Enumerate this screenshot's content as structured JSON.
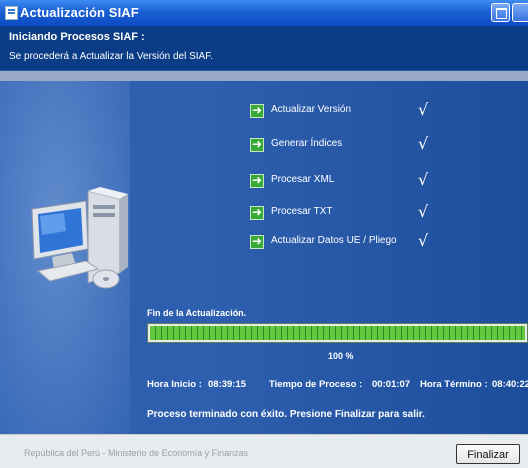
{
  "window": {
    "title": "Actualización SIAF",
    "title_icon": "app-icon"
  },
  "header": {
    "title": "Iniciando Procesos SIAF :",
    "subtitle": "Se procederá a Actualizar la Versión del SIAF."
  },
  "steps": [
    {
      "label": "Actualizar Versión",
      "icon": "arrow-right-icon",
      "done": true
    },
    {
      "label": "Generar Índices",
      "icon": "arrow-right-icon",
      "done": true
    },
    {
      "label": "Procesar XML",
      "icon": "arrow-right-icon",
      "done": true
    },
    {
      "label": "Procesar TXT",
      "icon": "arrow-right-icon",
      "done": true
    },
    {
      "label": "Actualizar Datos UE / Pliego",
      "icon": "arrow-right-icon",
      "done": true
    }
  ],
  "check_mark": "√",
  "progress": {
    "label": "Fin de la Actualización.",
    "value": 1.0,
    "percent_text": "100 %"
  },
  "times": {
    "start_label": "Hora Inicio :",
    "start_value": "08:39:15",
    "duration_label": "Tiempo de Proceso :",
    "duration_value": "00:01:07",
    "end_label": "Hora Término :",
    "end_value": "08:40:22"
  },
  "final_message": "Proceso terminado con éxito. Presione Finalizar para salir.",
  "footer": {
    "text": "República del Perú - Ministerio de Economía y Finanzas",
    "finalize_label": "Finalizar"
  },
  "colors": {
    "accent": "#0b3d86",
    "progress": "#44b02f",
    "body": "#2d60b2"
  }
}
